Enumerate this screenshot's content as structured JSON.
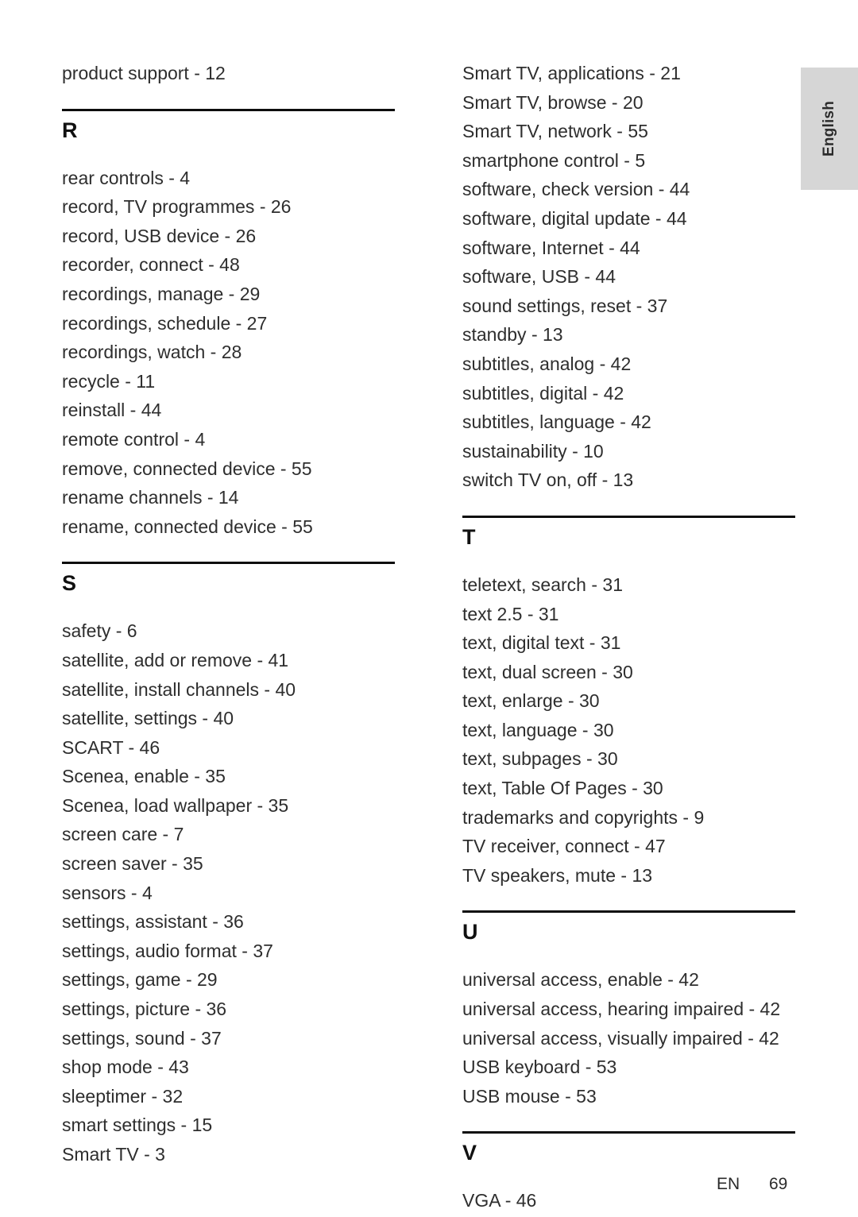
{
  "sidebar": {
    "language_tab_label": "English"
  },
  "footer": {
    "language_code": "EN",
    "page_number": "69"
  },
  "columns": {
    "left": {
      "orphan_entries": [
        "product support - 12"
      ],
      "groups": [
        {
          "letter": "R",
          "entries": [
            "rear controls - 4",
            "record, TV programmes - 26",
            "record, USB device - 26",
            "recorder, connect - 48",
            "recordings, manage - 29",
            "recordings, schedule - 27",
            "recordings, watch - 28",
            "recycle - 11",
            "reinstall - 44",
            "remote control - 4",
            "remove, connected device - 55",
            "rename channels - 14",
            "rename, connected device - 55"
          ]
        },
        {
          "letter": "S",
          "entries": [
            "safety - 6",
            "satellite, add or remove - 41",
            "satellite, install channels - 40",
            "satellite, settings - 40",
            "SCART - 46",
            "Scenea, enable - 35",
            "Scenea, load wallpaper - 35",
            "screen care - 7",
            "screen saver - 35",
            "sensors - 4",
            "settings, assistant - 36",
            "settings, audio format - 37",
            "settings, game - 29",
            "settings, picture - 36",
            "settings, sound - 37",
            "shop mode - 43",
            "sleeptimer - 32",
            "smart settings - 15",
            "Smart TV - 3"
          ]
        }
      ]
    },
    "right": {
      "orphan_entries": [
        "Smart TV, applications - 21",
        "Smart TV, browse - 20",
        "Smart TV, network - 55",
        "smartphone control - 5",
        "software, check version - 44",
        "software, digital update - 44",
        "software, Internet - 44",
        "software, USB - 44",
        "sound settings, reset - 37",
        "standby - 13",
        "subtitles, analog - 42",
        "subtitles, digital - 42",
        "subtitles, language - 42",
        "sustainability - 10",
        "switch TV on, off - 13"
      ],
      "groups": [
        {
          "letter": "T",
          "entries": [
            "teletext, search - 31",
            "text 2.5 - 31",
            "text, digital text - 31",
            "text, dual screen - 30",
            "text, enlarge - 30",
            "text, language - 30",
            "text, subpages - 30",
            "text, Table Of Pages - 30",
            "trademarks and copyrights - 9",
            "TV receiver, connect - 47",
            "TV speakers, mute - 13"
          ]
        },
        {
          "letter": "U",
          "entries": [
            "universal access, enable - 42",
            "universal access, hearing impaired - 42",
            "universal access, visually impaired - 42",
            "USB keyboard - 53",
            "USB mouse - 53"
          ]
        },
        {
          "letter": "V",
          "entries": [
            "VGA - 46"
          ]
        }
      ]
    }
  },
  "colors": {
    "text": "#2e2e2e",
    "heading": "#111111",
    "rule": "#0d0d0d",
    "tab_background": "#d6d6d6",
    "page_background": "#ffffff"
  }
}
